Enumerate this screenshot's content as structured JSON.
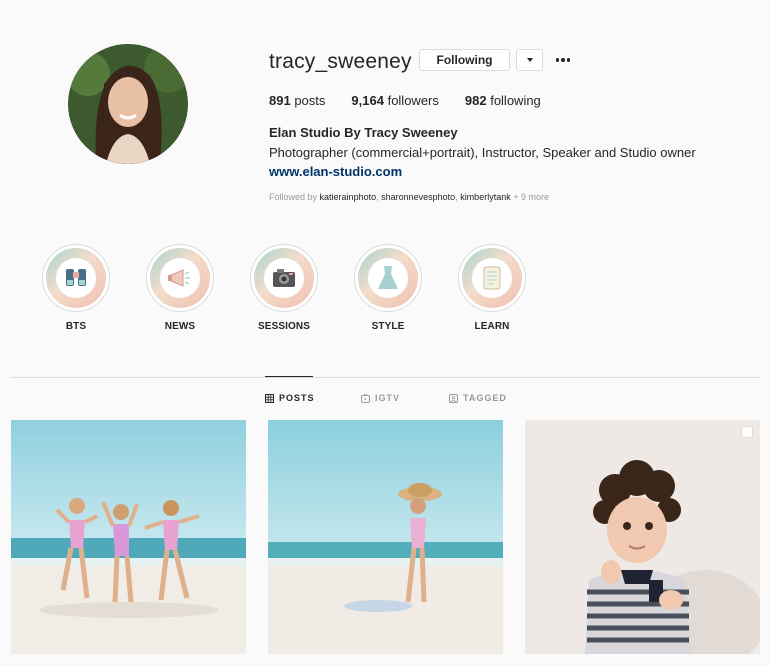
{
  "profile": {
    "username": "tracy_sweeney",
    "following_button_label": "Following",
    "stats": {
      "posts_count": "891",
      "posts_label": "posts",
      "followers_count": "9,164",
      "followers_label": "followers",
      "following_count": "982",
      "following_label": "following"
    },
    "full_name": "Elan Studio By Tracy Sweeney",
    "bio": "Photographer (commercial+portrait), Instructor, Speaker and Studio owner",
    "website": "www.elan-studio.com",
    "followed_by": {
      "prefix": "Followed by",
      "accounts": [
        "katierainphoto",
        "sharonnevesphoto",
        "kimberlytank"
      ],
      "more": "+ 9 more"
    }
  },
  "highlights": [
    {
      "label": "BTS",
      "icon": "binoculars-icon"
    },
    {
      "label": "NEWS",
      "icon": "megaphone-icon"
    },
    {
      "label": "SESSIONS",
      "icon": "camera-icon"
    },
    {
      "label": "STYLE",
      "icon": "dress-icon"
    },
    {
      "label": "LEARN",
      "icon": "scroll-icon"
    }
  ],
  "tabs": [
    {
      "label": "POSTS",
      "icon": "grid-icon",
      "active": true
    },
    {
      "label": "IGTV",
      "icon": "igtv-icon",
      "active": false
    },
    {
      "label": "TAGGED",
      "icon": "tagged-icon",
      "active": false
    }
  ],
  "posts": [
    {
      "subject": "three girls dancing on beach"
    },
    {
      "subject": "girl with straw hat on beach"
    },
    {
      "subject": "curly haired toddler portrait",
      "multi": true
    }
  ],
  "colors": {
    "text": "#262626",
    "muted": "#999999",
    "link": "#003569",
    "border": "#dbdbdb",
    "background": "#fafafa"
  }
}
